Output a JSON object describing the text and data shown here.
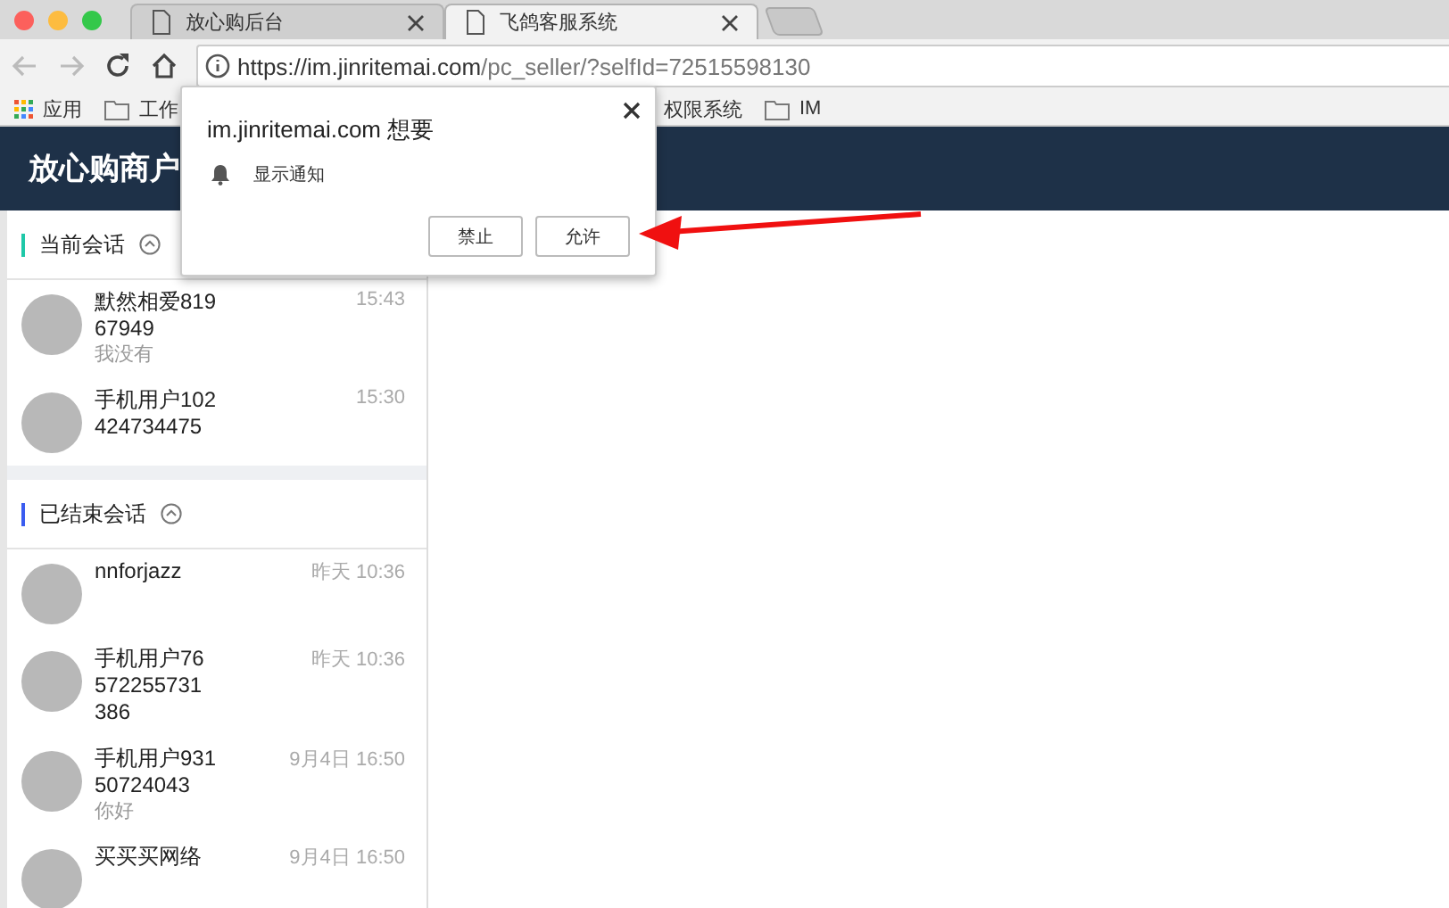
{
  "browser": {
    "tabs": [
      {
        "title": "放心购后台",
        "selected": false
      },
      {
        "title": "飞鸽客服系统",
        "selected": true
      }
    ],
    "url": {
      "host": "https://im.jinritemai.com",
      "path": "/pc_seller/?selfId=72515598130"
    },
    "bookmarks_left": [
      "应用",
      "工作"
    ],
    "bookmarks_right": [
      "权限系统",
      "IM"
    ]
  },
  "app_header": {
    "title": "放心购商户"
  },
  "sections": [
    {
      "title": "当前会话",
      "color": "#1fc8a8",
      "conversations": [
        {
          "name": "默然相爱819\n67949",
          "message": "我没有",
          "time": "15:43"
        },
        {
          "name": "手机用户102\n424734475",
          "time": "15:30"
        }
      ]
    },
    {
      "title": "已结束会话",
      "color": "#3a5cf0",
      "conversations": [
        {
          "name": "nnforjazz",
          "time": "昨天 10:36"
        },
        {
          "name": "手机用户76\n572255731\n386",
          "time": "昨天 10:36"
        },
        {
          "name": "手机用户931\n50724043",
          "message": "你好",
          "time": "9月4日 16:50"
        },
        {
          "name": "买买买网络",
          "time": "9月4日 16:50"
        }
      ]
    }
  ],
  "permission_dialog": {
    "title": "im.jinritemai.com 想要",
    "permission": "显示通知",
    "buttons": [
      "禁止",
      "允许"
    ]
  }
}
